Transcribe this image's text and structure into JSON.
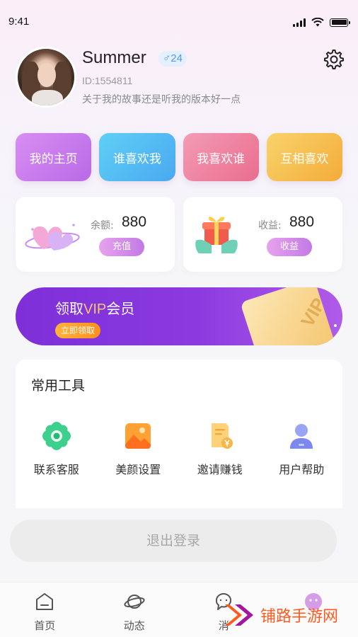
{
  "status_bar": {
    "time": "9:41"
  },
  "profile": {
    "name": "Summer",
    "gender_age": "♂24",
    "id": "ID:1554811",
    "bio": "关于我的故事还是听我的版本好一点"
  },
  "quick_actions": [
    "我的主页",
    "谁喜欢我",
    "我喜欢谁",
    "互相喜欢"
  ],
  "wallet": {
    "balance_label": "余额:",
    "balance_value": "880",
    "recharge_button": "充值",
    "earnings_label": "收益:",
    "earnings_value": "880",
    "earnings_button": "收益"
  },
  "vip_banner": {
    "title_prefix": "领取",
    "title_highlight": "VIP",
    "title_suffix": "会员",
    "button": "立即领取",
    "card_text": "VIP"
  },
  "tools": {
    "title": "常用工具",
    "items": [
      {
        "label": "联系客服",
        "icon": "customer-service-icon"
      },
      {
        "label": "美颜设置",
        "icon": "beauty-settings-icon"
      },
      {
        "label": "邀请赚钱",
        "icon": "invite-earn-icon"
      },
      {
        "label": "用户帮助",
        "icon": "user-help-icon"
      }
    ]
  },
  "logout_button": "退出登录",
  "tab_bar": [
    {
      "label": "首页",
      "icon": "home-icon"
    },
    {
      "label": "动态",
      "icon": "planet-icon"
    },
    {
      "label": "消",
      "icon": "message-icon"
    },
    {
      "label": "",
      "icon": "profile-icon"
    }
  ],
  "watermark": "铺路手游网",
  "colors": {
    "accent_purple": "#8b3ae0",
    "vip_gold": "#f6c66b",
    "gender_blue": "#4f9af2"
  }
}
